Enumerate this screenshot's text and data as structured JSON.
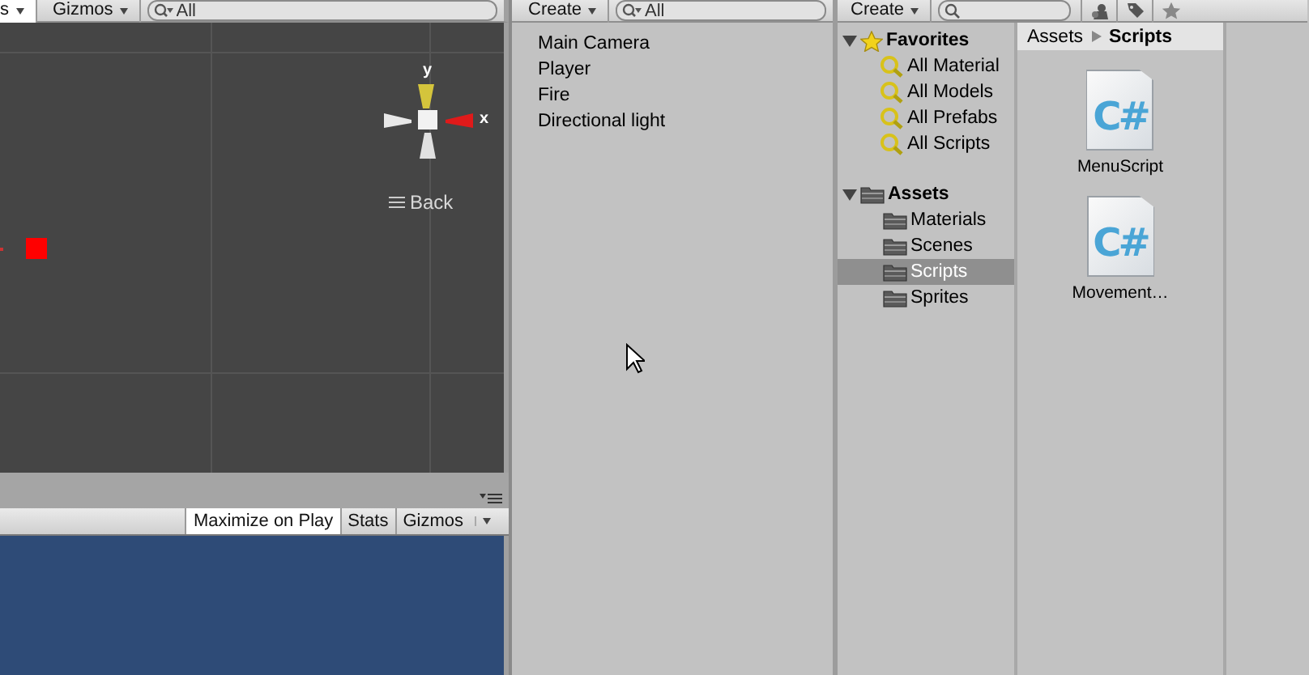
{
  "scene": {
    "toolbar": {
      "cut_label": "s",
      "gizmos": "Gizmos",
      "search": {
        "placeholder": "All"
      }
    },
    "axis_labels": {
      "y": "y",
      "x": "x"
    },
    "view_menu": "Back"
  },
  "game": {
    "toolbar": [
      {
        "label": "Maximize on Play",
        "selected": true,
        "kind": "toggle"
      },
      {
        "label": "Stats",
        "selected": false,
        "kind": "toggle"
      },
      {
        "label": "Gizmos",
        "selected": false,
        "kind": "dropdown"
      }
    ]
  },
  "hierarchy": {
    "create": "Create",
    "search": {
      "placeholder": "All"
    },
    "items": [
      "Main Camera",
      "Player",
      "Fire",
      "Directional light"
    ]
  },
  "project": {
    "create": "Create",
    "tree": [
      {
        "label": "Favorites",
        "kind": "favorites",
        "expanded": true,
        "selected": false,
        "children": [
          {
            "label": "All Material",
            "kind": "search",
            "selected": false
          },
          {
            "label": "All Models",
            "kind": "search",
            "selected": false
          },
          {
            "label": "All Prefabs",
            "kind": "search",
            "selected": false
          },
          {
            "label": "All Scripts",
            "kind": "search",
            "selected": false
          }
        ]
      },
      {
        "label": "Assets",
        "kind": "folder",
        "expanded": true,
        "selected": false,
        "children": [
          {
            "label": "Materials",
            "kind": "folder",
            "selected": false
          },
          {
            "label": "Scenes",
            "kind": "folder",
            "selected": false
          },
          {
            "label": "Scripts",
            "kind": "folder",
            "selected": true
          },
          {
            "label": "Sprites",
            "kind": "folder",
            "selected": false
          }
        ]
      }
    ],
    "breadcrumb": [
      "Assets",
      "Scripts"
    ],
    "assets": [
      {
        "name": "MenuScript",
        "icon_text": "C#"
      },
      {
        "name": "Movement…",
        "icon_text": "C#"
      }
    ]
  }
}
